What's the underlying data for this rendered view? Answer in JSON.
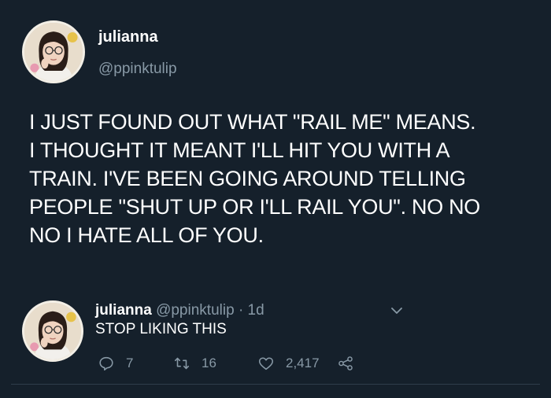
{
  "tweet": {
    "display_name": "julianna",
    "handle": "@ppinktulip",
    "text": "I JUST FOUND OUT WHAT \"RAIL ME\" MEANS.\nI THOUGHT IT MEANT I'LL HIT YOU WITH A\nTRAIN. I'VE BEEN GOING AROUND TELLING\nPEOPLE \"SHUT UP OR I'LL RAIL YOU\". NO NO\nNO I HATE ALL OF YOU."
  },
  "reply": {
    "display_name": "julianna",
    "handle": "@ppinktulip",
    "separator": "·",
    "time": "1d",
    "text": "STOP LIKING THIS",
    "actions": {
      "reply_count": "7",
      "retweet_count": "16",
      "like_count": "2,417"
    }
  },
  "icons": {
    "reply": "comment-icon",
    "retweet": "retweet-icon",
    "like": "heart-icon",
    "share": "share-icon",
    "more": "chevron-down-icon"
  },
  "colors": {
    "background": "#15202b",
    "text": "#ffffff",
    "secondary": "#8899a6"
  }
}
